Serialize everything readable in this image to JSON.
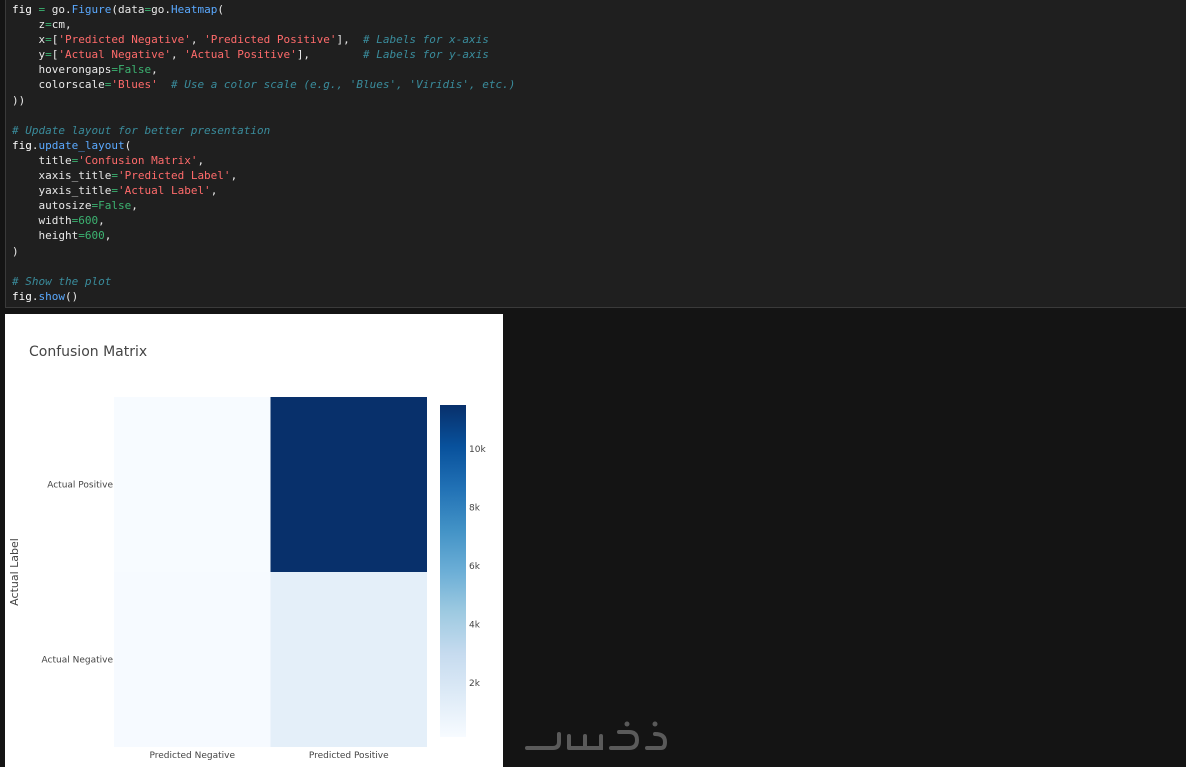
{
  "code_lines": [
    [
      [
        "var",
        "fig"
      ],
      [
        "plain",
        " "
      ],
      [
        "op",
        "="
      ],
      [
        "plain",
        " go."
      ],
      [
        "fn",
        "Figure"
      ],
      [
        "plain",
        "(data"
      ],
      [
        "op",
        "="
      ],
      [
        "plain",
        "go."
      ],
      [
        "fn",
        "Heatmap"
      ],
      [
        "plain",
        "("
      ]
    ],
    [
      [
        "plain",
        "    z"
      ],
      [
        "op",
        "="
      ],
      [
        "plain",
        "cm,"
      ]
    ],
    [
      [
        "plain",
        "    x"
      ],
      [
        "op",
        "="
      ],
      [
        "plain",
        "["
      ],
      [
        "str",
        "'Predicted Negative'"
      ],
      [
        "plain",
        ", "
      ],
      [
        "str",
        "'Predicted Positive'"
      ],
      [
        "plain",
        "],  "
      ],
      [
        "com",
        "# Labels for x-axis"
      ]
    ],
    [
      [
        "plain",
        "    y"
      ],
      [
        "op",
        "="
      ],
      [
        "plain",
        "["
      ],
      [
        "str",
        "'Actual Negative'"
      ],
      [
        "plain",
        ", "
      ],
      [
        "str",
        "'Actual Positive'"
      ],
      [
        "plain",
        "],        "
      ],
      [
        "com",
        "# Labels for y-axis"
      ]
    ],
    [
      [
        "plain",
        "    hoverongaps"
      ],
      [
        "op",
        "="
      ],
      [
        "kw-false",
        "False"
      ],
      [
        "plain",
        ","
      ]
    ],
    [
      [
        "plain",
        "    colorscale"
      ],
      [
        "op",
        "="
      ],
      [
        "str",
        "'Blues'"
      ],
      [
        "plain",
        "  "
      ],
      [
        "com",
        "# Use a color scale (e.g., 'Blues', 'Viridis', etc.)"
      ]
    ],
    [
      [
        "plain",
        "))"
      ]
    ],
    [
      [
        "plain",
        ""
      ]
    ],
    [
      [
        "com",
        "# Update layout for better presentation"
      ]
    ],
    [
      [
        "var",
        "fig"
      ],
      [
        "plain",
        "."
      ],
      [
        "fn",
        "update_layout"
      ],
      [
        "plain",
        "("
      ]
    ],
    [
      [
        "plain",
        "    title"
      ],
      [
        "op",
        "="
      ],
      [
        "str",
        "'Confusion Matrix'"
      ],
      [
        "plain",
        ","
      ]
    ],
    [
      [
        "plain",
        "    xaxis_title"
      ],
      [
        "op",
        "="
      ],
      [
        "str",
        "'Predicted Label'"
      ],
      [
        "plain",
        ","
      ]
    ],
    [
      [
        "plain",
        "    yaxis_title"
      ],
      [
        "op",
        "="
      ],
      [
        "str",
        "'Actual Label'"
      ],
      [
        "plain",
        ","
      ]
    ],
    [
      [
        "plain",
        "    autosize"
      ],
      [
        "op",
        "="
      ],
      [
        "kw-false",
        "False"
      ],
      [
        "plain",
        ","
      ]
    ],
    [
      [
        "plain",
        "    width"
      ],
      [
        "op",
        "="
      ],
      [
        "num",
        "600"
      ],
      [
        "plain",
        ","
      ]
    ],
    [
      [
        "plain",
        "    height"
      ],
      [
        "op",
        "="
      ],
      [
        "num",
        "600"
      ],
      [
        "plain",
        ","
      ]
    ],
    [
      [
        "plain",
        ")"
      ]
    ],
    [
      [
        "plain",
        ""
      ]
    ],
    [
      [
        "com",
        "# Show the plot"
      ]
    ],
    [
      [
        "var",
        "fig"
      ],
      [
        "plain",
        "."
      ],
      [
        "fn",
        "show"
      ],
      [
        "plain",
        "()"
      ]
    ]
  ],
  "chart_data": {
    "type": "heatmap",
    "title": "Confusion Matrix",
    "ylabel": "Actual Label",
    "x_categories": [
      "Predicted Negative",
      "Predicted Positive"
    ],
    "y_categories": [
      "Actual Negative",
      "Actual Positive"
    ],
    "z": [
      [
        200,
        1200
      ],
      [
        150,
        11500
      ]
    ],
    "colorscale": "Blues",
    "colorbar_ticks": [
      "2k",
      "4k",
      "6k",
      "8k",
      "10k"
    ],
    "colorbar_tick_values": [
      2000,
      4000,
      6000,
      8000,
      10000
    ],
    "zlim": [
      150,
      11500
    ]
  },
  "colors": {
    "code_bg": "#1f1f1f",
    "page_bg": "#141414",
    "blues_low": "#f7fbff",
    "blues_high": "#08306b"
  },
  "watermark": "خمسات"
}
